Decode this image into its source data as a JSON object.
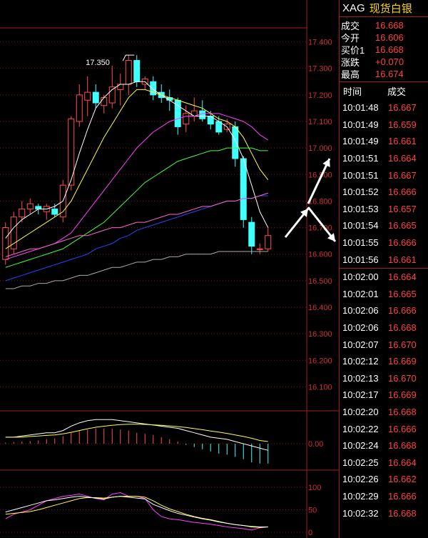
{
  "header": {
    "symbol": "XAG",
    "name": "现货白银"
  },
  "quote": [
    {
      "label": "成交",
      "value": "16.668"
    },
    {
      "label": "今开",
      "value": "16.606"
    },
    {
      "label": "买价1",
      "value": "16.668"
    },
    {
      "label": "涨跌",
      "value": "+0.070"
    },
    {
      "label": "最高",
      "value": "16.674"
    }
  ],
  "ticks_header": {
    "time": "时间",
    "price": "成交"
  },
  "ticks_top": [
    {
      "time": "10:01:48",
      "price": "16.667"
    },
    {
      "time": "10:01:49",
      "price": "16.659"
    },
    {
      "time": "10:01:49",
      "price": "16.661"
    },
    {
      "time": "10:01:51",
      "price": "16.664"
    },
    {
      "time": "10:01:51",
      "price": "16.667"
    },
    {
      "time": "10:01:52",
      "price": "16.666"
    },
    {
      "time": "10:01:53",
      "price": "16.657"
    },
    {
      "time": "10:01:54",
      "price": "16.665"
    },
    {
      "time": "10:01:55",
      "price": "16.666"
    },
    {
      "time": "10:01:56",
      "price": "16.661"
    }
  ],
  "ticks_bottom": [
    {
      "time": "10:02:00",
      "price": "16.664"
    },
    {
      "time": "10:02:01",
      "price": "16.665"
    },
    {
      "time": "10:02:06",
      "price": "16.666"
    },
    {
      "time": "10:02:06",
      "price": "16.668"
    },
    {
      "time": "10:02:07",
      "price": "16.670"
    },
    {
      "time": "10:02:12",
      "price": "16.669"
    },
    {
      "time": "10:02:13",
      "price": "16.670"
    },
    {
      "time": "10:02:17",
      "price": "16.669"
    },
    {
      "time": "10:02:20",
      "price": "16.668"
    },
    {
      "time": "10:02:22",
      "price": "16.666"
    },
    {
      "time": "10:02:24",
      "price": "16.668"
    },
    {
      "time": "10:02:25",
      "price": "16.664"
    },
    {
      "time": "10:02:26",
      "price": "16.662"
    },
    {
      "time": "10:02:29",
      "price": "16.666"
    },
    {
      "time": "10:02:32",
      "price": "16.668"
    }
  ],
  "chart_data": {
    "type": "candlestick",
    "main_axis": {
      "ylim": [
        16.05,
        17.45
      ],
      "ticks": [
        "17.400",
        "17.300",
        "17.200",
        "17.100",
        "17.000",
        "16.900",
        "16.800",
        "16.700",
        "16.600",
        "16.500",
        "16.400",
        "16.300",
        "16.200",
        "16.100"
      ]
    },
    "high_label": "17.350",
    "candles": [
      {
        "o": 16.58,
        "h": 16.72,
        "l": 16.56,
        "c": 16.7
      },
      {
        "o": 16.62,
        "h": 16.76,
        "l": 16.6,
        "c": 16.74
      },
      {
        "o": 16.74,
        "h": 16.8,
        "l": 16.72,
        "c": 16.77
      },
      {
        "o": 16.77,
        "h": 16.81,
        "l": 16.75,
        "c": 16.79
      },
      {
        "o": 16.78,
        "h": 16.79,
        "l": 16.75,
        "c": 16.77
      },
      {
        "o": 16.76,
        "h": 16.79,
        "l": 16.73,
        "c": 16.78
      },
      {
        "o": 16.77,
        "h": 16.79,
        "l": 16.74,
        "c": 16.75
      },
      {
        "o": 16.74,
        "h": 16.88,
        "l": 16.72,
        "c": 16.86
      },
      {
        "o": 16.86,
        "h": 17.12,
        "l": 16.84,
        "c": 17.11
      },
      {
        "o": 17.1,
        "h": 17.24,
        "l": 17.08,
        "c": 17.2
      },
      {
        "o": 17.18,
        "h": 17.27,
        "l": 17.12,
        "c": 17.21
      },
      {
        "o": 17.21,
        "h": 17.24,
        "l": 17.15,
        "c": 17.17
      },
      {
        "o": 17.16,
        "h": 17.2,
        "l": 17.13,
        "c": 17.19
      },
      {
        "o": 17.17,
        "h": 17.31,
        "l": 17.15,
        "c": 17.23
      },
      {
        "o": 17.22,
        "h": 17.28,
        "l": 17.16,
        "c": 17.24
      },
      {
        "o": 17.24,
        "h": 17.35,
        "l": 17.2,
        "c": 17.33
      },
      {
        "o": 17.33,
        "h": 17.35,
        "l": 17.23,
        "c": 17.25
      },
      {
        "o": 17.24,
        "h": 17.27,
        "l": 17.22,
        "c": 17.26
      },
      {
        "o": 17.25,
        "h": 17.27,
        "l": 17.18,
        "c": 17.2
      },
      {
        "o": 17.21,
        "h": 17.24,
        "l": 17.17,
        "c": 17.19
      },
      {
        "o": 17.19,
        "h": 17.22,
        "l": 17.14,
        "c": 17.18
      },
      {
        "o": 17.18,
        "h": 17.19,
        "l": 17.05,
        "c": 17.08
      },
      {
        "o": 17.09,
        "h": 17.16,
        "l": 17.06,
        "c": 17.13
      },
      {
        "o": 17.12,
        "h": 17.19,
        "l": 17.1,
        "c": 17.14
      },
      {
        "o": 17.14,
        "h": 17.18,
        "l": 17.1,
        "c": 17.11
      },
      {
        "o": 17.12,
        "h": 17.14,
        "l": 17.07,
        "c": 17.09
      },
      {
        "o": 17.1,
        "h": 17.12,
        "l": 17.05,
        "c": 17.06
      },
      {
        "o": 17.07,
        "h": 17.11,
        "l": 17.06,
        "c": 17.09
      },
      {
        "o": 17.08,
        "h": 17.1,
        "l": 16.93,
        "c": 16.96
      },
      {
        "o": 16.96,
        "h": 16.97,
        "l": 16.7,
        "c": 16.73
      },
      {
        "o": 16.72,
        "h": 16.74,
        "l": 16.6,
        "c": 16.63
      },
      {
        "o": 16.62,
        "h": 16.64,
        "l": 16.6,
        "c": 16.62
      },
      {
        "o": 16.62,
        "h": 16.7,
        "l": 16.61,
        "c": 16.67
      }
    ],
    "ma_lines": [
      {
        "color": "#ffffff",
        "values": [
          16.66,
          16.7,
          16.73,
          16.75,
          16.77,
          16.77,
          16.78,
          16.8,
          16.88,
          16.98,
          17.07,
          17.15,
          17.19,
          17.22,
          17.24,
          17.24,
          17.25,
          17.25,
          17.22,
          17.2,
          17.18,
          17.16,
          17.14,
          17.12,
          17.12,
          17.12,
          17.1,
          17.08,
          17.03,
          16.96,
          16.86,
          16.76,
          16.7
        ]
      },
      {
        "color": "#ffff40",
        "values": [
          16.62,
          16.64,
          16.66,
          16.68,
          16.7,
          16.72,
          16.74,
          16.76,
          16.8,
          16.86,
          16.92,
          16.98,
          17.04,
          17.09,
          17.14,
          17.19,
          17.22,
          17.22,
          17.21,
          17.2,
          17.19,
          17.18,
          17.17,
          17.16,
          17.15,
          17.13,
          17.11,
          17.1,
          17.08,
          17.04,
          16.98,
          16.92,
          16.88
        ]
      },
      {
        "color": "#ff40ff",
        "values": [
          16.58,
          16.59,
          16.6,
          16.61,
          16.62,
          16.63,
          16.64,
          16.66,
          16.68,
          16.72,
          16.76,
          16.8,
          16.84,
          16.88,
          16.92,
          16.96,
          17.0,
          17.03,
          17.06,
          17.08,
          17.1,
          17.11,
          17.12,
          17.12,
          17.13,
          17.13,
          17.13,
          17.12,
          17.11,
          17.1,
          17.08,
          17.05,
          17.03
        ]
      },
      {
        "color": "#40ff40",
        "values": [
          16.55,
          16.56,
          16.57,
          16.58,
          16.59,
          16.6,
          16.61,
          16.62,
          16.64,
          16.66,
          16.68,
          16.7,
          16.72,
          16.75,
          16.78,
          16.81,
          16.84,
          16.87,
          16.89,
          16.91,
          16.93,
          16.95,
          16.96,
          16.97,
          16.98,
          16.99,
          16.99,
          17.0,
          17.0,
          17.0,
          17.0,
          16.99,
          16.99
        ]
      },
      {
        "color": "#3040ff",
        "values": [
          16.5,
          16.51,
          16.52,
          16.53,
          16.54,
          16.55,
          16.56,
          16.57,
          16.58,
          16.59,
          16.6,
          16.62,
          16.63,
          16.64,
          16.66,
          16.67,
          16.69,
          16.7,
          16.71,
          16.72,
          16.73,
          16.74,
          16.75,
          16.76,
          16.77,
          16.78,
          16.79,
          16.8,
          16.8,
          16.81,
          16.81,
          16.82,
          16.82
        ]
      },
      {
        "color": "#ff66cc",
        "values": [
          16.59,
          16.6,
          16.61,
          16.62,
          16.62,
          16.63,
          16.64,
          16.65,
          16.66,
          16.67,
          16.67,
          16.68,
          16.69,
          16.7,
          16.7,
          16.71,
          16.72,
          16.72,
          16.73,
          16.74,
          16.75,
          16.75,
          16.76,
          16.77,
          16.78,
          16.78,
          16.79,
          16.8,
          16.8,
          16.81,
          16.81,
          16.82,
          16.83
        ]
      },
      {
        "color": "#aaaaaa",
        "values": [
          16.47,
          16.47,
          16.48,
          16.48,
          16.49,
          16.49,
          16.5,
          16.5,
          16.51,
          16.52,
          16.52,
          16.53,
          16.54,
          16.55,
          16.55,
          16.56,
          16.57,
          16.57,
          16.58,
          16.58,
          16.59,
          16.59,
          16.6,
          16.6,
          16.6,
          16.6,
          16.61,
          16.61,
          16.61,
          16.61,
          16.61,
          16.61,
          16.61
        ]
      }
    ],
    "macd": {
      "ylim": [
        -0.12,
        0.14
      ],
      "tick": "0.00",
      "hist": [
        0.005,
        0.008,
        0.01,
        0.012,
        0.015,
        0.02,
        0.025,
        0.035,
        0.05,
        0.06,
        0.065,
        0.07,
        0.07,
        0.068,
        0.065,
        0.06,
        0.05,
        0.045,
        0.04,
        0.03,
        0.02,
        0.01,
        -0.005,
        -0.015,
        -0.025,
        -0.035,
        -0.045,
        -0.05,
        -0.06,
        -0.07,
        -0.085,
        -0.09,
        -0.09
      ],
      "dif": [
        0.03,
        0.03,
        0.035,
        0.04,
        0.045,
        0.05,
        0.05,
        0.06,
        0.08,
        0.095,
        0.105,
        0.11,
        0.11,
        0.11,
        0.105,
        0.1,
        0.095,
        0.09,
        0.085,
        0.08,
        0.075,
        0.07,
        0.06,
        0.05,
        0.04,
        0.03,
        0.025,
        0.02,
        0.01,
        0.0,
        -0.01,
        -0.02,
        -0.03
      ],
      "dea": [
        0.03,
        0.03,
        0.03,
        0.033,
        0.035,
        0.038,
        0.04,
        0.045,
        0.052,
        0.06,
        0.068,
        0.075,
        0.08,
        0.084,
        0.087,
        0.089,
        0.089,
        0.088,
        0.086,
        0.084,
        0.081,
        0.078,
        0.074,
        0.069,
        0.064,
        0.058,
        0.053,
        0.047,
        0.04,
        0.033,
        0.025,
        0.015,
        0.01
      ]
    },
    "kdj": {
      "ylim": [
        0,
        100
      ],
      "ticks": [
        "100",
        "50",
        "0"
      ],
      "k": [
        30,
        40,
        45,
        50,
        60,
        70,
        75,
        80,
        82,
        85,
        80,
        75,
        72,
        85,
        88,
        80,
        80,
        75,
        50,
        35,
        30,
        28,
        25,
        22,
        20,
        18,
        15,
        12,
        10,
        8,
        5,
        10,
        12
      ],
      "d": [
        40,
        42,
        44,
        46,
        50,
        55,
        60,
        65,
        70,
        75,
        77,
        77,
        76,
        78,
        80,
        80,
        80,
        78,
        70,
        60,
        52,
        46,
        40,
        35,
        31,
        28,
        24,
        20,
        17,
        15,
        12,
        11,
        12
      ],
      "j": [
        45,
        50,
        55,
        60,
        65,
        70,
        72,
        75,
        78,
        80,
        78,
        76,
        74,
        78,
        80,
        78,
        76,
        74,
        62,
        55,
        48,
        42,
        38,
        34,
        30,
        27,
        23,
        20,
        17,
        15,
        13,
        12,
        12
      ]
    }
  }
}
